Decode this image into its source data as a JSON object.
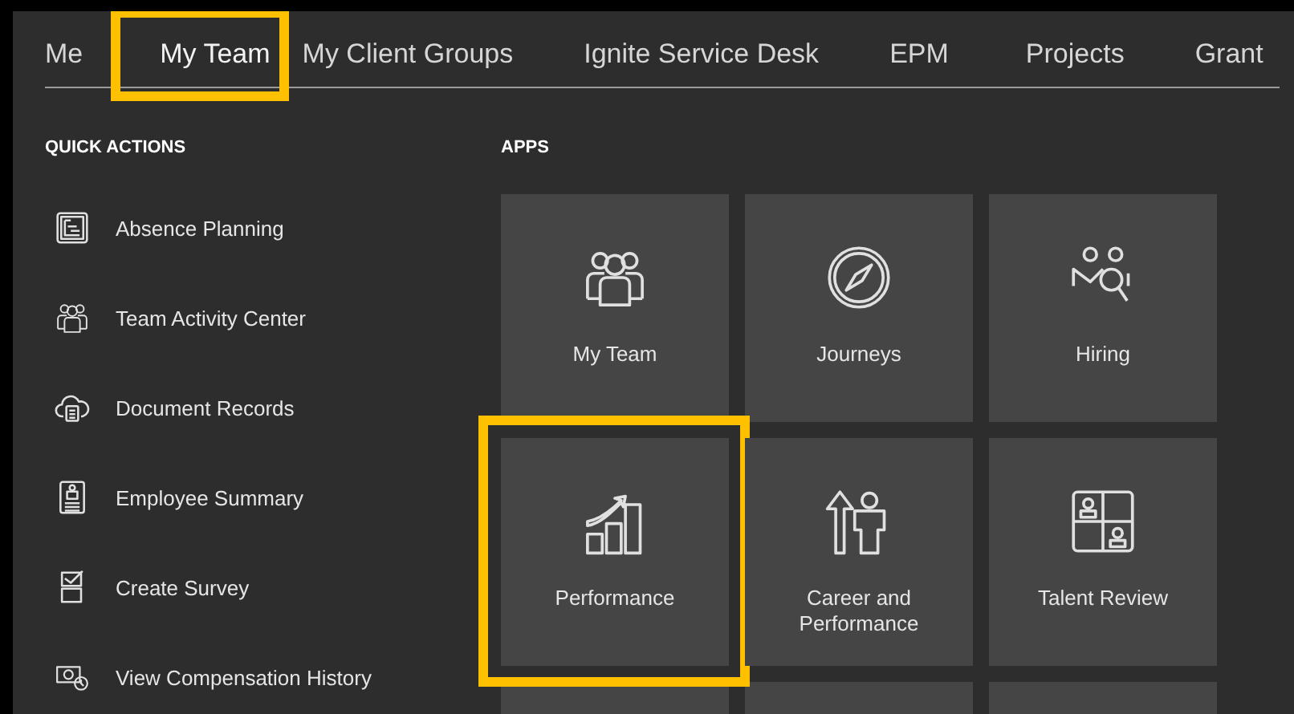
{
  "tabs": [
    {
      "label": "Me",
      "selected": false,
      "highlighted": false
    },
    {
      "label": "My Team",
      "selected": true,
      "highlighted": true
    },
    {
      "label": "My Client Groups",
      "selected": false,
      "highlighted": false
    },
    {
      "label": "Ignite Service Desk",
      "selected": false,
      "highlighted": false
    },
    {
      "label": "EPM",
      "selected": false,
      "highlighted": false
    },
    {
      "label": "Projects",
      "selected": false,
      "highlighted": false
    },
    {
      "label": "Grant",
      "selected": false,
      "highlighted": false
    }
  ],
  "quick_actions": {
    "heading": "QUICK ACTIONS",
    "items": [
      {
        "label": "Absence Planning",
        "kind": "chart"
      },
      {
        "label": "Team Activity Center",
        "kind": "team"
      },
      {
        "label": "Document Records",
        "kind": "cloud"
      },
      {
        "label": "Employee Summary",
        "kind": "badge"
      },
      {
        "label": "Create Survey",
        "kind": "survey"
      },
      {
        "label": "View Compensation History",
        "kind": "money"
      }
    ]
  },
  "apps": {
    "heading": "APPS",
    "tiles": [
      {
        "label": "My Team",
        "kind": "team",
        "highlighted": false
      },
      {
        "label": "Journeys",
        "kind": "compass",
        "highlighted": false
      },
      {
        "label": "Hiring",
        "kind": "hiring",
        "highlighted": false
      },
      {
        "label": "Performance",
        "kind": "growth",
        "highlighted": true
      },
      {
        "label": "Career and Performance",
        "kind": "career",
        "highlighted": false
      },
      {
        "label": "Talent Review",
        "kind": "grid",
        "highlighted": false
      }
    ]
  }
}
